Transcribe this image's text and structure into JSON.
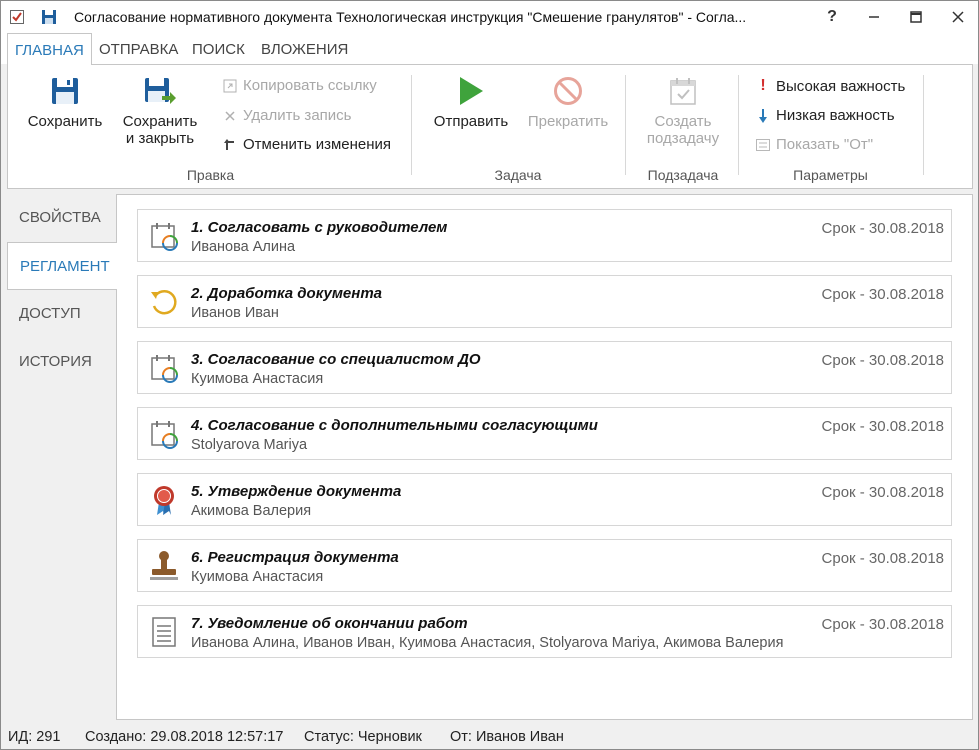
{
  "window": {
    "title": "Согласование нормативного документа Технологическая инструкция \"Смешение гранулятов\" - Согла...",
    "help_label": "?",
    "accent_color": "#2a7ab8"
  },
  "ribbon_tabs": [
    {
      "label": "ГЛАВНАЯ",
      "active": true
    },
    {
      "label": "ОТПРАВКА",
      "active": false
    },
    {
      "label": "ПОИСК",
      "active": false
    },
    {
      "label": "ВЛОЖЕНИЯ",
      "active": false
    }
  ],
  "ribbon": {
    "save_label": "Сохранить",
    "save_close_label_1": "Сохранить",
    "save_close_label_2": "и закрыть",
    "copy_link_label": "Копировать ссылку",
    "delete_record_label": "Удалить запись",
    "undo_changes_label": "Отменить изменения",
    "group_edit": "Правка",
    "send_label": "Отправить",
    "stop_label": "Прекратить",
    "group_task": "Задача",
    "create_subtask_label_1": "Создать",
    "create_subtask_label_2": "подзадачу",
    "group_subtask": "Подзадача",
    "high_importance_label": "Высокая важность",
    "low_importance_label": "Низкая важность",
    "show_from_label": "Показать \"От\"",
    "group_params": "Параметры"
  },
  "side_tabs": [
    {
      "label": "СВОЙСТВА",
      "active": false
    },
    {
      "label": "РЕГЛАМЕНТ",
      "active": true
    },
    {
      "label": "ДОСТУП",
      "active": false
    },
    {
      "label": "ИСТОРИЯ",
      "active": false
    }
  ],
  "steps": [
    {
      "title": "1. Согласовать с руководителем",
      "people": "Иванова Алина",
      "due": "Срок - 30.08.2018",
      "icon": "calendar-approval-icon"
    },
    {
      "title": "2. Доработка документа",
      "people": "Иванов Иван",
      "due": "Срок - 30.08.2018",
      "icon": "rework-icon"
    },
    {
      "title": "3. Согласование со специалистом ДО",
      "people": "Куимова Анастасия",
      "due": "Срок - 30.08.2018",
      "icon": "calendar-approval-icon"
    },
    {
      "title": "4. Согласование с дополнительными согласующими",
      "people": "Stolyarova Mariya",
      "due": "Срок - 30.08.2018",
      "icon": "calendar-approval-icon"
    },
    {
      "title": "5. Утверждение документа",
      "people": "Акимова Валерия",
      "due": "Срок - 30.08.2018",
      "icon": "award-icon"
    },
    {
      "title": "6. Регистрация документа",
      "people": "Куимова Анастасия",
      "due": "Срок - 30.08.2018",
      "icon": "stamp-icon"
    },
    {
      "title": "7. Уведомление об окончании работ",
      "people": "Иванова Алина, Иванов Иван, Куимова Анастасия, Stolyarova Mariya, Акимова Валерия",
      "due": "Срок - 30.08.2018",
      "icon": "document-icon"
    }
  ],
  "status": {
    "id": "ИД: 291",
    "created": "Создано: 29.08.2018 12:57:17",
    "status": "Статус: Черновик",
    "from": "От: Иванов Иван"
  }
}
